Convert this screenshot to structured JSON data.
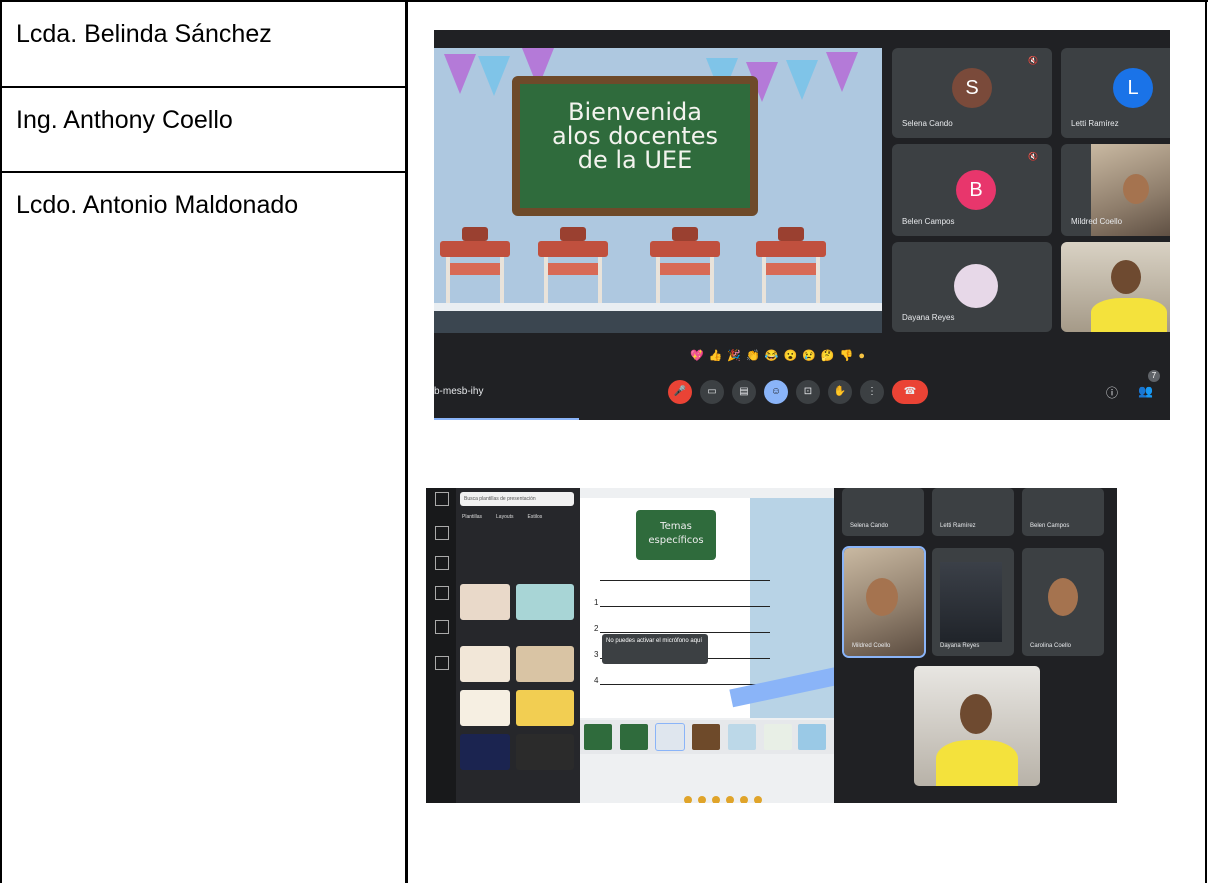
{
  "people": [
    {
      "name": "Lcda. Belinda Sánchez"
    },
    {
      "name": "Ing. Anthony Coello"
    },
    {
      "name": "Lcdo. Antonio Maldonado"
    }
  ],
  "meet1": {
    "slide_lines": [
      "Bienvenida",
      "alos docentes",
      "de la  UEE"
    ],
    "meeting_code": "b-mesb-ihy",
    "participants": [
      {
        "initial": "S",
        "name": "Selena Cando",
        "color": "#7a4a3a"
      },
      {
        "initial": "L",
        "name": "Letti Ramírez",
        "color": "#1a73e8"
      },
      {
        "initial": "B",
        "name": "Belen Campos",
        "color": "#e8366c"
      },
      {
        "name": "Mildred Coello"
      },
      {
        "name": "Dayana Reyes"
      },
      {
        "name": ""
      }
    ],
    "reactions": [
      "💖",
      "👍",
      "🎉",
      "👏",
      "😂",
      "😮",
      "😢",
      "🤔",
      "👎",
      "●"
    ],
    "controls": {
      "mic": "🎤",
      "camera": "▭",
      "captions": "▤",
      "emoji": "☺",
      "present": "⊡",
      "raise_hand": "✋",
      "more": "⋮",
      "hangup": "☎"
    },
    "info_icon": "ⓘ",
    "people_icon": "👥",
    "participant_count": "7"
  },
  "meet2": {
    "search_placeholder": "Busca plantillas de presentación",
    "tabs": [
      "Plantillas",
      "Layouts",
      "Estilos"
    ],
    "slide_title": "Temas específicos",
    "tooltip": "No puedes activar el micrófono aquí",
    "row_numbers": [
      "1",
      "2",
      "3",
      "4"
    ],
    "participants": [
      {
        "name": "Selena Cando"
      },
      {
        "name": "Letti Ramírez"
      },
      {
        "name": "Belen Campos"
      },
      {
        "name": "Mildred Coello"
      },
      {
        "name": "Dayana Reyes"
      },
      {
        "name": "Carolina Coello"
      }
    ]
  }
}
